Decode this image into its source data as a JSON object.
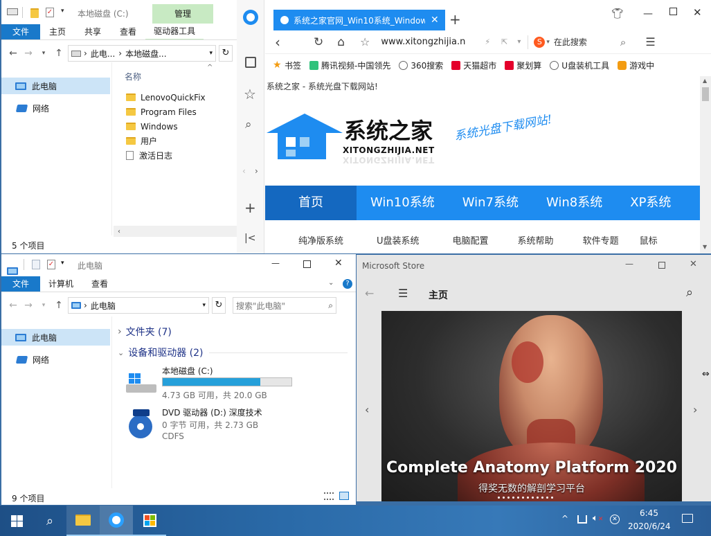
{
  "explorer_c": {
    "title": "本地磁盘 (C:)",
    "manage_tab": "管理",
    "ribbon_tabs": [
      "文件",
      "主页",
      "共享",
      "查看",
      "驱动器工具"
    ],
    "breadcrumb": [
      "此电...",
      "本地磁盘..."
    ],
    "column_name": "名称",
    "nav": [
      "此电脑",
      "网络"
    ],
    "items": [
      "LenovoQuickFix",
      "Program Files",
      "Windows",
      "用户",
      "激活日志"
    ],
    "status": "5 个项目"
  },
  "explorer_pc": {
    "title": "此电脑",
    "ribbon_tabs": [
      "文件",
      "计算机",
      "查看"
    ],
    "breadcrumb": "此电脑",
    "search_placeholder": "搜索\"此电脑\"",
    "nav": [
      "此电脑",
      "网络"
    ],
    "group_folders": "文件夹 (7)",
    "group_devices": "设备和驱动器 (2)",
    "drive_c": {
      "name": "本地磁盘 (C:)",
      "space": "4.73 GB 可用，共 20.0 GB",
      "used_fraction": 0.76
    },
    "drive_d": {
      "name": "DVD 驱动器 (D:) 深度技术",
      "space": "0 字节 可用，共 2.73 GB",
      "fs": "CDFS"
    },
    "status": "9 个项目"
  },
  "browser": {
    "tab_title": "系统之家官网_Win10系统_Window",
    "url": "www.xitongzhijia.n",
    "search_label": "在此搜索",
    "bookmarks": [
      "书签",
      "腾讯视频-中国领先",
      "360搜索",
      "天猫超市",
      "聚划算",
      "U盘装机工具",
      "游戏中"
    ],
    "page_header": "系统之家 - 系统光盘下载网站!",
    "logo_cn": "系统之家",
    "logo_en": "XITONGZHIJIA.NET",
    "logo_en_reflect": "XITONGZHIJIA.NET",
    "slogan": "系统光盘下载网站!",
    "main_nav": [
      "首页",
      "Win10系统",
      "Win7系统",
      "Win8系统",
      "XP系统"
    ],
    "sub_nav": [
      "纯净版系统",
      "U盘装系统",
      "电脑配置",
      "系统帮助",
      "软件专题",
      "鼠标"
    ],
    "accent": "#1e8cf0"
  },
  "store": {
    "title": "Microsoft Store",
    "heading": "主页",
    "hero_title": "Complete Anatomy Platform 2020",
    "hero_sub": "得奖无数的解剖学习平台"
  },
  "taskbar": {
    "time": "6:45",
    "date": "2020/6/24"
  }
}
